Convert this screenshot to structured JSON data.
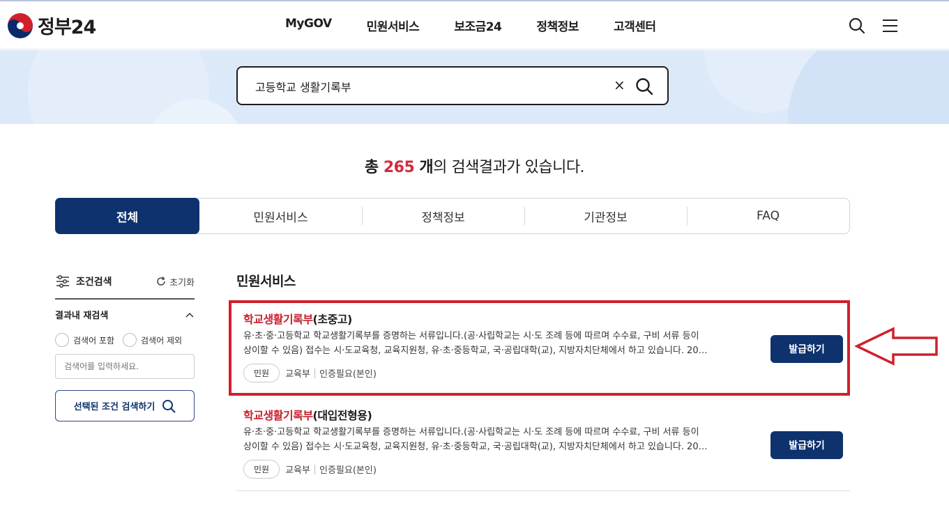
{
  "header": {
    "logo_text": "정부24",
    "nav": [
      "MyGOV",
      "민원서비스",
      "보조금24",
      "정책정보",
      "고객센터"
    ]
  },
  "search": {
    "query": "고등학교 생활기록부",
    "clear_label": "×"
  },
  "result_summary": {
    "prefix": "총 ",
    "count": "265",
    "unit": " 개",
    "suffix": "의 검색결과가 있습니다."
  },
  "tabs": [
    "전체",
    "민원서비스",
    "정책정보",
    "기관정보",
    "FAQ"
  ],
  "sidebar": {
    "title": "조건검색",
    "reset_label": "초기화",
    "subheading": "결과내 재검색",
    "radio_include": "검색어 포함",
    "radio_exclude": "검색어 제외",
    "keyword_placeholder": "검색어를 입력하세요.",
    "search_button": "선택된 조건 검색하기"
  },
  "section_title": "민원서비스",
  "results": [
    {
      "title_highlight": "학교생활기록부",
      "title_rest": "(초중고)",
      "desc_line1": "유·초·중·고등학교 학교생활기록부를 증명하는 서류입니다.(공·사립학교는 시·도 조례 등에 따르며 수수료, 구비 서류 등이",
      "desc_line2": "상이할 수 있음) 접수는 시·도교육청, 교육지원청, 유·초·중등학교, 국·공립대학(교), 지방자치단체에서 하고 있습니다. 20…",
      "badge": "민원",
      "agency": "교육부",
      "auth": "인증필요(본인)",
      "button": "발급하기"
    },
    {
      "title_highlight": "학교생활기록부",
      "title_rest": "(대입전형용)",
      "desc_line1": "유·초·중·고등학교 학교생활기록부를 증명하는 서류입니다.(공·사립학교는 시·도 조례 등에 따르며 수수료, 구비 서류 등이",
      "desc_line2": "상이할 수 있음) 접수는 시·도교육청, 교육지원청, 유·초·중등학교, 국·공립대학(교), 지방자치단체에서 하고 있습니다. 20…",
      "badge": "민원",
      "agency": "교육부",
      "auth": "인증필요(본인)",
      "button": "발급하기"
    }
  ],
  "colors": {
    "brand_navy": "#0e326e",
    "highlight_red": "#c6202e",
    "annotation_red": "#d0202c"
  }
}
